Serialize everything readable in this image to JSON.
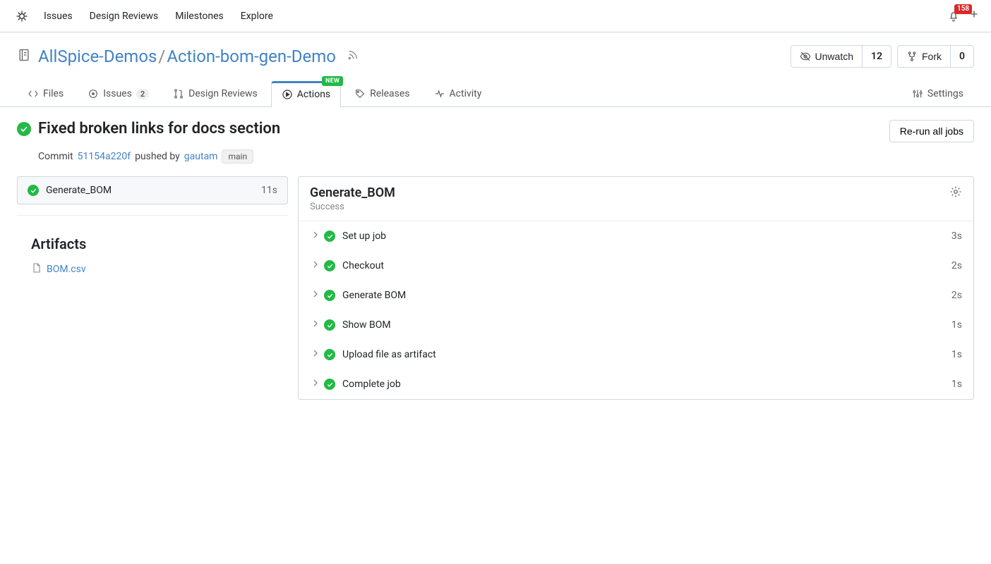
{
  "topnav": {
    "items": [
      "Issues",
      "Design Reviews",
      "Milestones",
      "Explore"
    ],
    "notif_count": "158"
  },
  "repo": {
    "owner": "AllSpice-Demos",
    "name": "Action-bom-gen-Demo",
    "watch_label": "Unwatch",
    "watch_count": "12",
    "fork_label": "Fork",
    "fork_count": "0"
  },
  "tabs": {
    "files": "Files",
    "issues": "Issues",
    "issues_count": "2",
    "design_reviews": "Design Reviews",
    "actions": "Actions",
    "actions_badge": "NEW",
    "releases": "Releases",
    "activity": "Activity",
    "settings": "Settings"
  },
  "run": {
    "title": "Fixed broken links for docs section",
    "commit_label": "Commit",
    "commit_hash": "51154a220f",
    "pushed_by_label": "pushed by",
    "author": "gautam",
    "branch": "main",
    "rerun_label": "Re-run all jobs"
  },
  "sidebar": {
    "jobs": [
      {
        "name": "Generate_BOM",
        "time": "11s"
      }
    ],
    "artifacts_heading": "Artifacts",
    "artifacts": [
      {
        "name": "BOM.csv"
      }
    ]
  },
  "panel": {
    "title": "Generate_BOM",
    "status": "Success",
    "steps": [
      {
        "name": "Set up job",
        "time": "3s"
      },
      {
        "name": "Checkout",
        "time": "2s"
      },
      {
        "name": "Generate BOM",
        "time": "2s"
      },
      {
        "name": "Show BOM",
        "time": "1s"
      },
      {
        "name": "Upload file as artifact",
        "time": "1s"
      },
      {
        "name": "Complete job",
        "time": "1s"
      }
    ]
  }
}
